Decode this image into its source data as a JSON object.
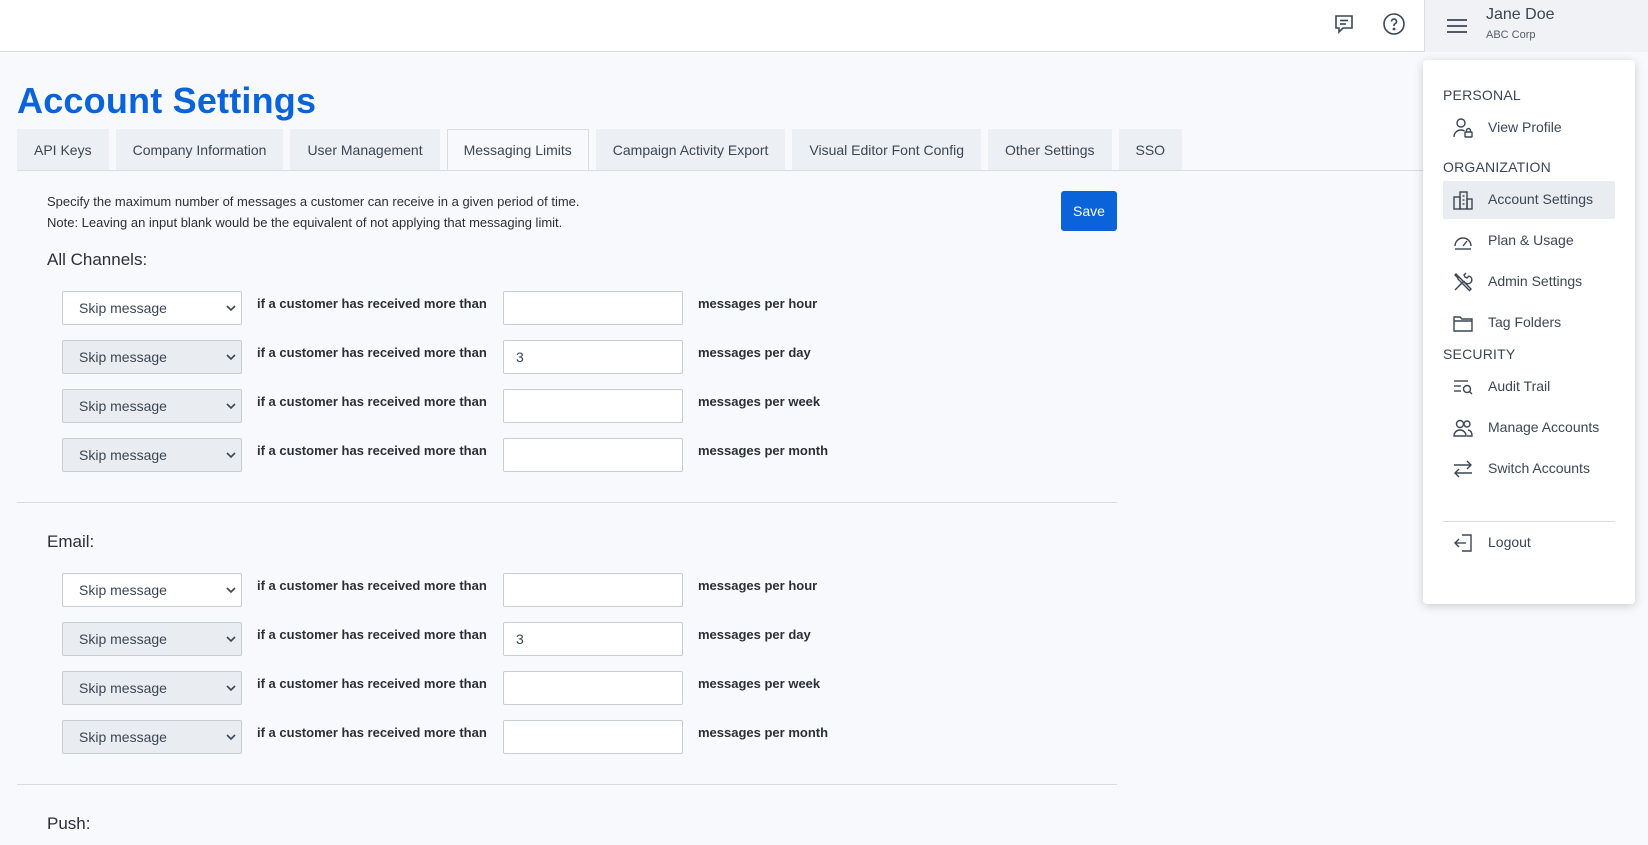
{
  "user": {
    "name": "Jane Doe",
    "org": "ABC Corp"
  },
  "page": {
    "title": "Account Settings"
  },
  "tabs": [
    {
      "label": "API Keys"
    },
    {
      "label": "Company Information"
    },
    {
      "label": "User Management"
    },
    {
      "label": "Messaging Limits",
      "active": true
    },
    {
      "label": "Campaign Activity Export"
    },
    {
      "label": "Visual Editor Font Config"
    },
    {
      "label": "Other Settings"
    },
    {
      "label": "SSO"
    }
  ],
  "description": {
    "line1": "Specify the maximum number of messages a customer can receive in a given period of time.",
    "line2": "Note: Leaving an input blank would be the equivalent of not applying that messaging limit."
  },
  "save_label": "Save",
  "condition_text": "if a customer has received more than",
  "sections": [
    {
      "title": "All Channels:",
      "rows": [
        {
          "action": "Skip message",
          "value": "",
          "unit": "messages per hour"
        },
        {
          "action": "Skip message",
          "value": "3",
          "unit": "messages per day"
        },
        {
          "action": "Skip message",
          "value": "",
          "unit": "messages per week"
        },
        {
          "action": "Skip message",
          "value": "",
          "unit": "messages per month"
        }
      ]
    },
    {
      "title": "Email:",
      "rows": [
        {
          "action": "Skip message",
          "value": "",
          "unit": "messages per hour"
        },
        {
          "action": "Skip message",
          "value": "3",
          "unit": "messages per day"
        },
        {
          "action": "Skip message",
          "value": "",
          "unit": "messages per week"
        },
        {
          "action": "Skip message",
          "value": "",
          "unit": "messages per month"
        }
      ]
    },
    {
      "title": "Push:",
      "rows": []
    }
  ],
  "menu": {
    "personal_heading": "PERSONAL",
    "organization_heading": "ORGANIZATION",
    "security_heading": "SECURITY",
    "items": {
      "view_profile": "View Profile",
      "account_settings": "Account Settings",
      "plan_usage": "Plan & Usage",
      "admin_settings": "Admin Settings",
      "tag_folders": "Tag Folders",
      "audit_trail": "Audit Trail",
      "manage_accounts": "Manage Accounts",
      "switch_accounts": "Switch Accounts",
      "logout": "Logout"
    }
  },
  "colors": {
    "brand": "#0a63d9",
    "menu_active_bg": "#e9ecf0"
  }
}
